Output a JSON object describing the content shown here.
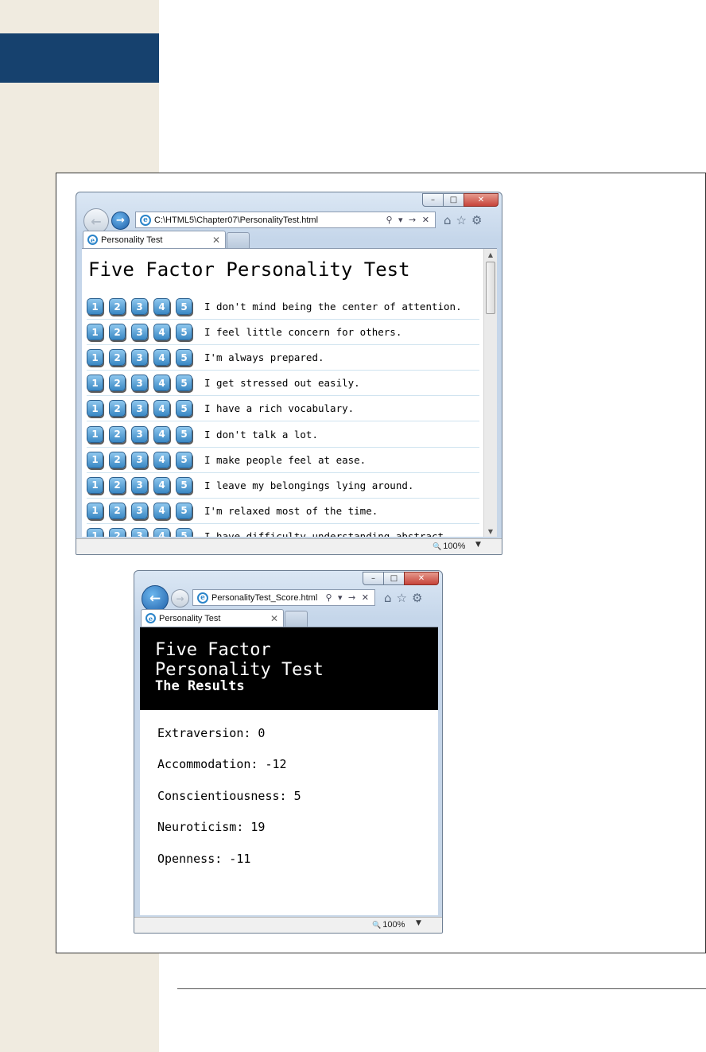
{
  "window1": {
    "address": "C:\\HTML5\\Chapter07\\PersonalityTest.html",
    "address_tools": "⚲ ▾ → ✕",
    "tab_title": "Personality Test",
    "page_title": "Five Factor Personality Test",
    "rating_labels": [
      "1",
      "2",
      "3",
      "4",
      "5"
    ],
    "questions": [
      "I don't mind being the center of attention.",
      "I feel little concern for others.",
      "I'm always prepared.",
      "I get stressed out easily.",
      "I have a rich vocabulary.",
      "I don't talk a lot.",
      "I make people feel at ease.",
      "I leave my belongings lying around.",
      "I'm relaxed most of the time.",
      "I have difficulty understanding abstract"
    ],
    "zoom": "100%"
  },
  "window2": {
    "address": "PersonalityTest_Score.html",
    "address_tools": "⚲ ▾ → ✕",
    "tab_title": "Personality Test",
    "header_line1": "Five Factor",
    "header_line2": "Personality Test",
    "header_sub": "The Results",
    "scores": [
      "Extraversion: 0",
      "Accommodation: -12",
      "Conscientiousness: 5",
      "Neuroticism: 19",
      "Openness: -11"
    ],
    "zoom": "100%"
  },
  "icons": {
    "minimize": "–",
    "maximize": "□",
    "close": "✕",
    "back": "←",
    "forward": "→",
    "home": "⌂",
    "favorites": "☆",
    "tools": "⚙",
    "tab_close": "✕",
    "zoom": "🔍",
    "dropdown": "▼",
    "scroll_up": "▲",
    "scroll_down": "▼"
  }
}
